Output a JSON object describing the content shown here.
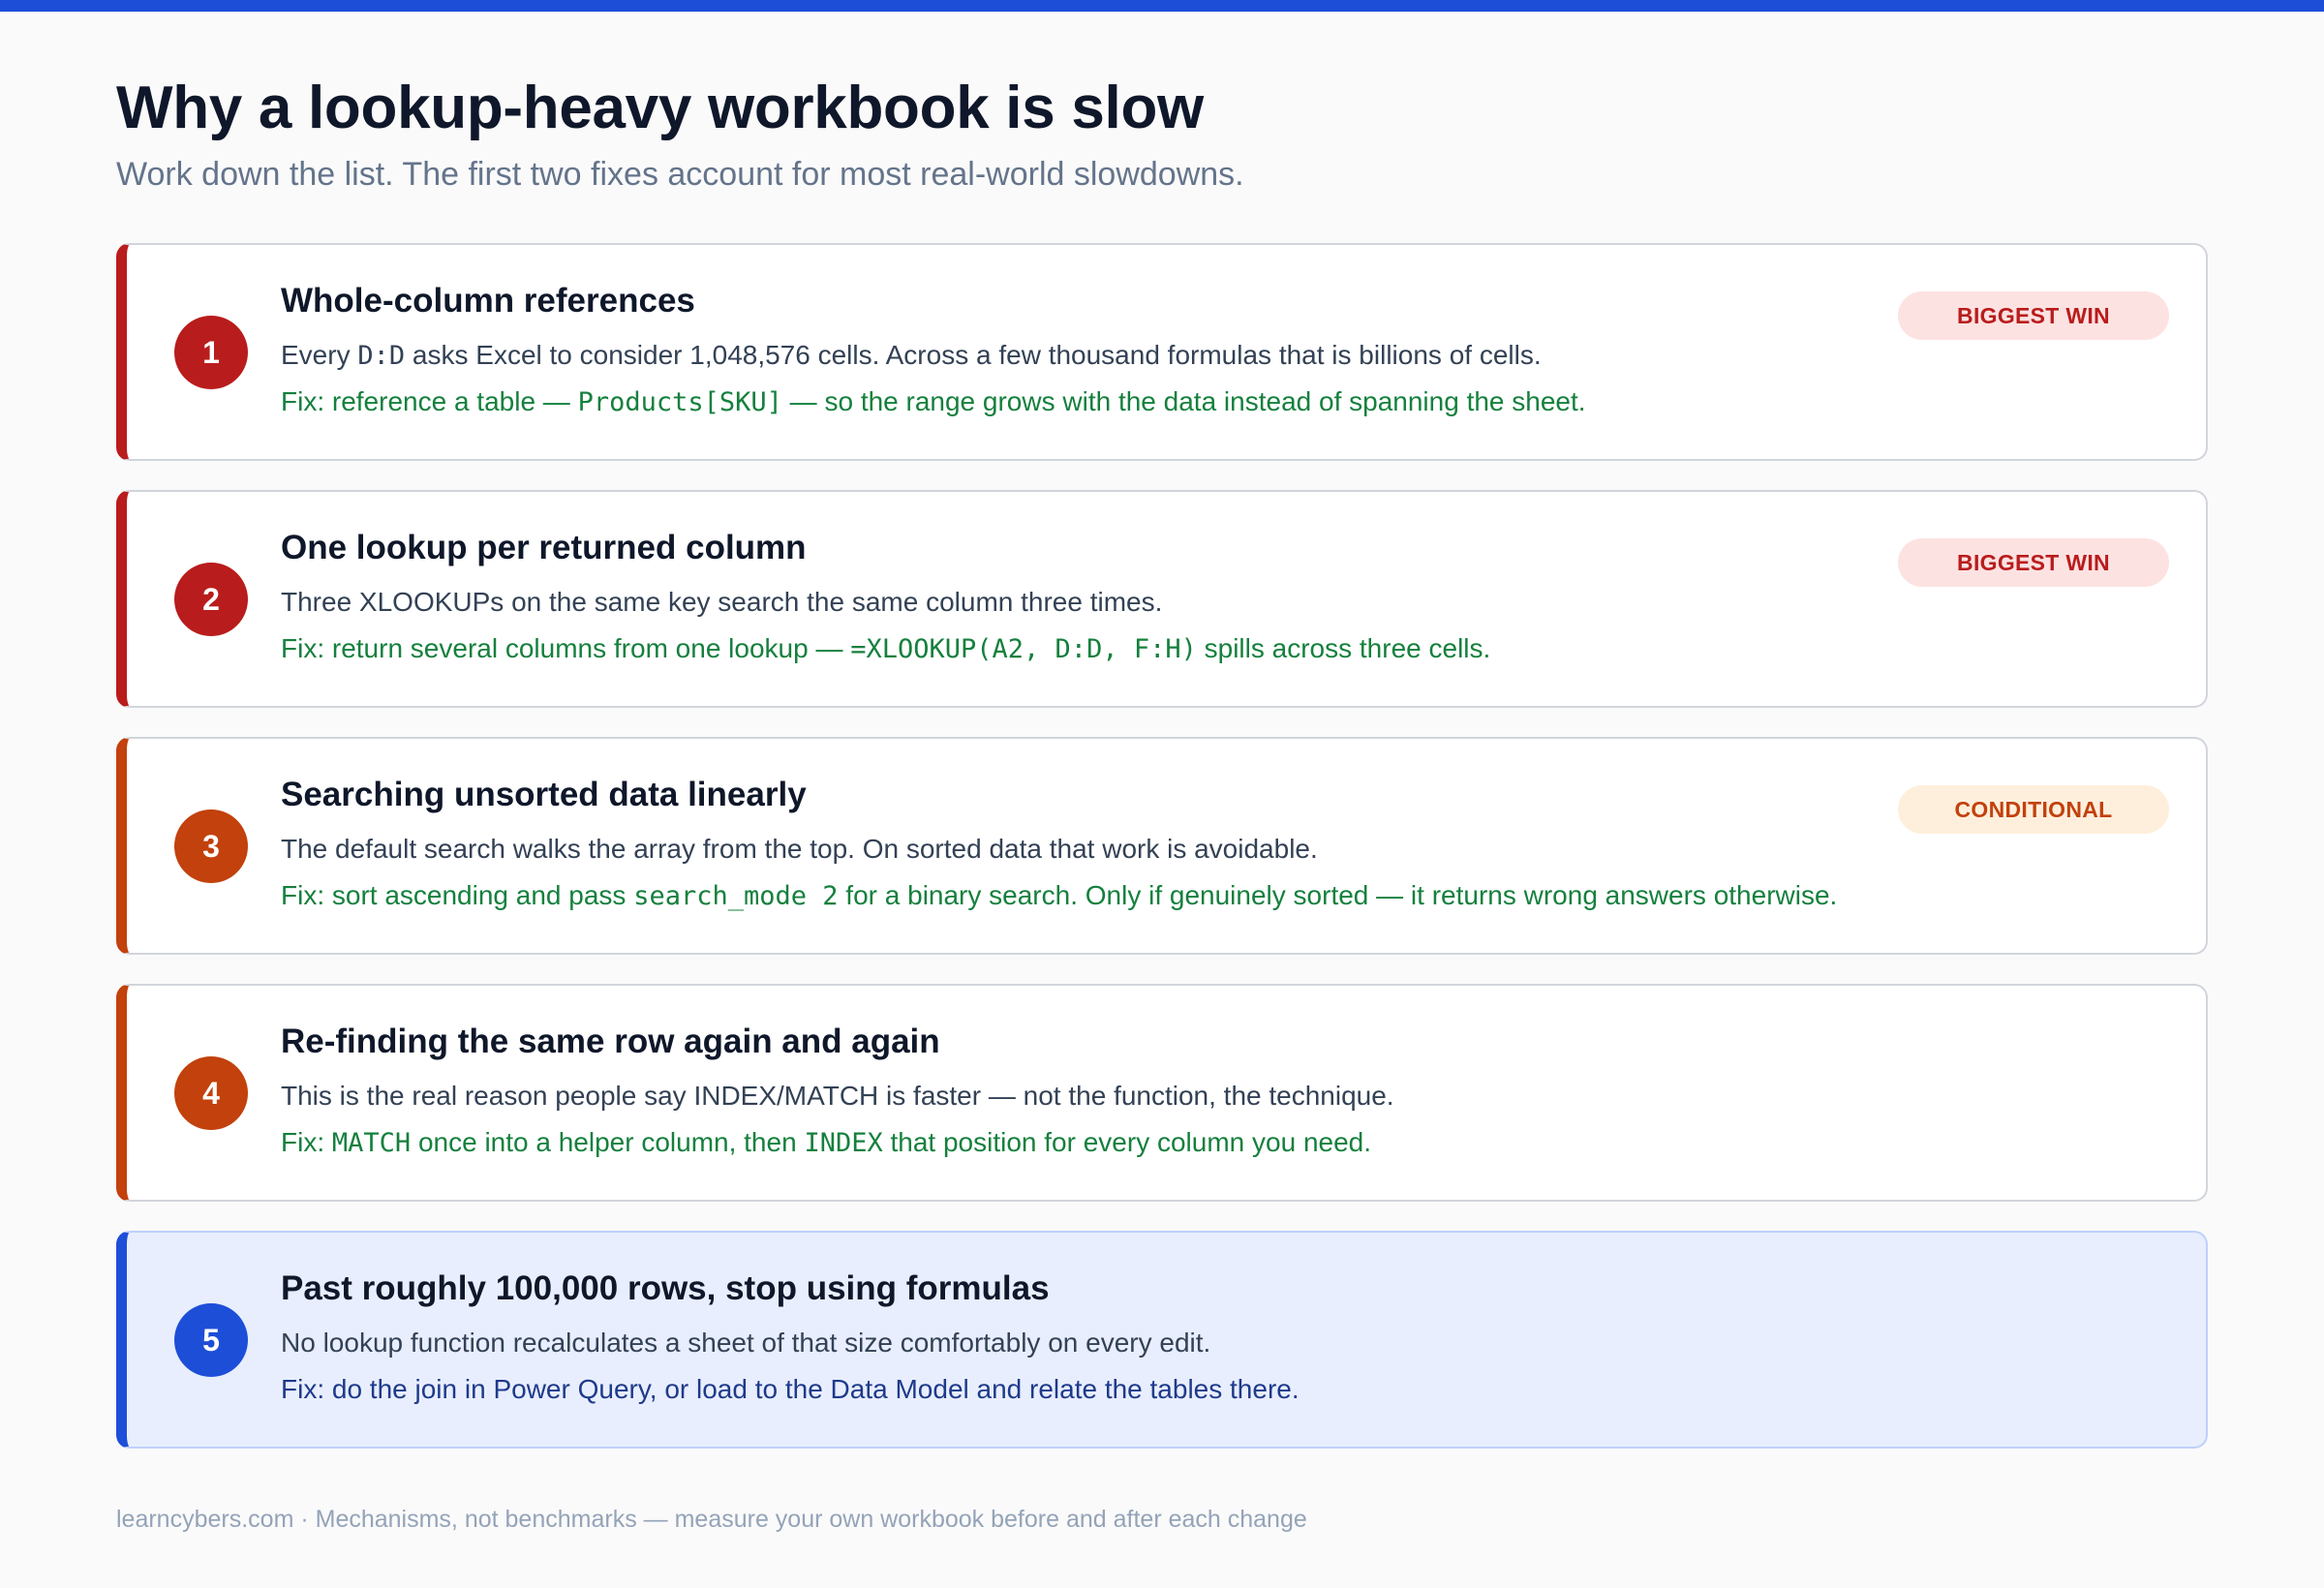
{
  "colors": {
    "accent": "#1d4ed8",
    "severity_high": "#b91c1c",
    "severity_medium": "#c2410c",
    "fix_text": "#15803d"
  },
  "header": {
    "title": "Why a lookup-heavy workbook is slow",
    "subtitle": "Work down the list. The first two fixes account for most real-world slowdowns."
  },
  "items": [
    {
      "number": "1",
      "title": "Whole-column references",
      "badge": "BIGGEST WIN",
      "body": {
        "pre": "Every ",
        "code": "D:D",
        "post": " asks Excel to consider 1,048,576 cells. Across a few thousand formulas that is billions of cells."
      },
      "fix": {
        "pre": "Fix: reference a table — ",
        "code": "Products[SKU]",
        "post": " — so the range grows with the data instead of spanning the sheet."
      }
    },
    {
      "number": "2",
      "title": "One lookup per returned column",
      "badge": "BIGGEST WIN",
      "body": "Three XLOOKUPs on the same key search the same column three times.",
      "fix": {
        "pre": "Fix: return several columns from one lookup — ",
        "code": "=XLOOKUP(A2, D:D, F:H)",
        "post": " spills across three cells."
      }
    },
    {
      "number": "3",
      "title": "Searching unsorted data linearly",
      "badge": "CONDITIONAL",
      "body": "The default search walks the array from the top. On sorted data that work is avoidable.",
      "fix": {
        "pre": "Fix: sort ascending and pass ",
        "code": "search_mode 2",
        "post": " for a binary search. Only if genuinely sorted — it returns wrong answers otherwise."
      }
    },
    {
      "number": "4",
      "title": "Re-finding the same row again and again",
      "body": "This is the real reason people say INDEX/MATCH is faster — not the function, the technique.",
      "fix": {
        "pre": "Fix: ",
        "code1": "MATCH",
        "mid": " once into a helper column, then ",
        "code2": "INDEX",
        "post": " that position for every column you need."
      }
    },
    {
      "number": "5",
      "title": "Past roughly 100,000 rows, stop using formulas",
      "body": "No lookup function recalculates a sheet of that size comfortably on every edit.",
      "fix": "Fix: do the join in Power Query, or load to the Data Model and relate the tables there."
    }
  ],
  "footer": "learncybers.com · Mechanisms, not benchmarks — measure your own workbook before and after each change"
}
